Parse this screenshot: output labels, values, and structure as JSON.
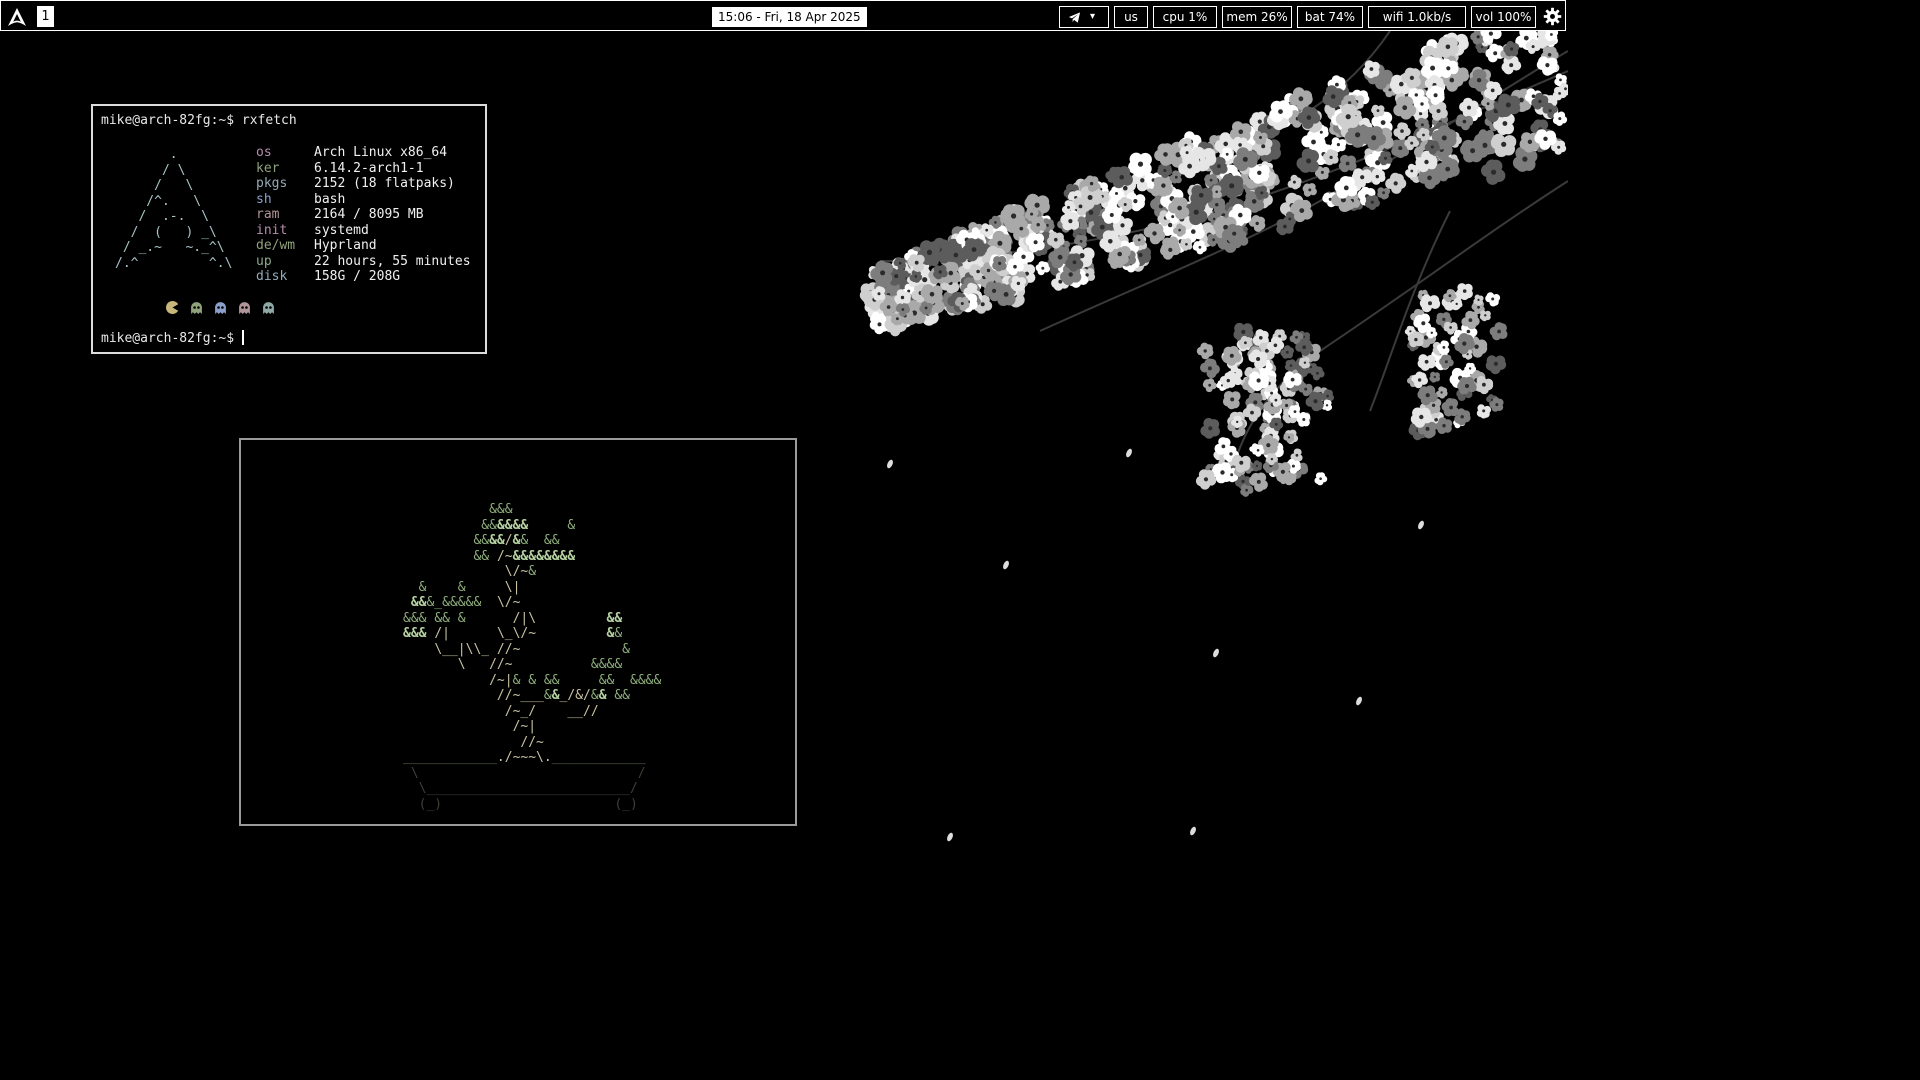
{
  "topbar": {
    "workspace": "1",
    "clock": "15:06 - Fri, 18 Apr 2025",
    "tray_label": "▾",
    "keyboard_layout": "us",
    "cpu": "cpu 1%",
    "mem": "mem 26%",
    "bat": "bat 74%",
    "wifi": "wifi 1.0kb/s",
    "vol": "vol 100%",
    "icons": [
      "arch-logo-icon",
      "telegram-icon",
      "gear-icon"
    ]
  },
  "fetch_terminal": {
    "prompt_user": "mike@arch-82fg:~$",
    "command": "rxfetch",
    "info": [
      {
        "key": "os",
        "value": "Arch Linux x86_64",
        "color": "#b48ead"
      },
      {
        "key": "ker",
        "value": "6.14.2-arch1-1",
        "color": "#8fa27b"
      },
      {
        "key": "pkgs",
        "value": "2152 (18 flatpaks)",
        "color": "#94a9b8"
      },
      {
        "key": "sh",
        "value": "bash",
        "color": "#8aa0c8"
      },
      {
        "key": "ram",
        "value": "2164 / 8095 MB",
        "color": "#b19498"
      },
      {
        "key": "init",
        "value": "systemd",
        "color": "#b48ead"
      },
      {
        "key": "de/wm",
        "value": "Hyprland",
        "color": "#8fa27b"
      },
      {
        "key": "up",
        "value": "22 hours, 55 minutes",
        "color": "#8ea890"
      },
      {
        "key": "disk",
        "value": "158G / 208G",
        "color": "#94a9b8"
      }
    ],
    "second_prompt": "mike@arch-82fg:~$"
  },
  "colors": {
    "pacman": "#c8b77a",
    "ghosts": [
      "#8fa27b",
      "#8aa0c8",
      "#b19498",
      "#8ea8a6"
    ]
  }
}
